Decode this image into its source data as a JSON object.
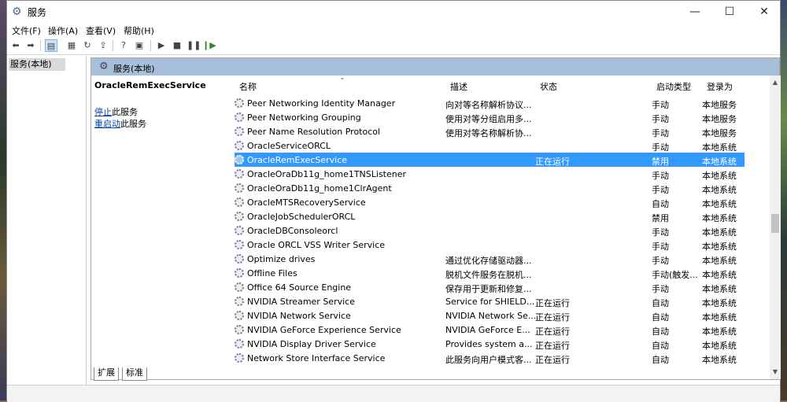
{
  "window": {
    "title": "服务"
  },
  "menu": [
    "文件(F)",
    "操作(A)",
    "查看(V)",
    "帮助(H)"
  ],
  "tree": {
    "selected": "服务(本地)"
  },
  "panel": {
    "header": "服务(本地)",
    "selected_service": "OracleRemExecService",
    "stop_link": "停止",
    "stop_suffix": "此服务",
    "restart_link": "重启动",
    "restart_suffix": "此服务"
  },
  "columns": [
    "名称",
    "描述",
    "状态",
    "启动类型",
    "登录为"
  ],
  "services": [
    {
      "name": "Peer Networking Identity Manager",
      "desc": "向对等名称解析协议...",
      "status": "",
      "startup": "手动",
      "logon": "本地服务"
    },
    {
      "name": "Peer Networking Grouping",
      "desc": "使用对等分组启用多...",
      "status": "",
      "startup": "手动",
      "logon": "本地服务"
    },
    {
      "name": "Peer Name Resolution Protocol",
      "desc": "使用对等名称解析协...",
      "status": "",
      "startup": "手动",
      "logon": "本地服务"
    },
    {
      "name": "OracleServiceORCL",
      "desc": "",
      "status": "",
      "startup": "手动",
      "logon": "本地系统"
    },
    {
      "name": "OracleRemExecService",
      "desc": "",
      "status": "正在运行",
      "startup": "禁用",
      "logon": "本地系统",
      "selected": true
    },
    {
      "name": "OracleOraDb11g_home1TNSListener",
      "desc": "",
      "status": "",
      "startup": "手动",
      "logon": "本地系统"
    },
    {
      "name": "OracleOraDb11g_home1ClrAgent",
      "desc": "",
      "status": "",
      "startup": "手动",
      "logon": "本地系统"
    },
    {
      "name": "OracleMTSRecoveryService",
      "desc": "",
      "status": "",
      "startup": "自动",
      "logon": "本地系统"
    },
    {
      "name": "OracleJobSchedulerORCL",
      "desc": "",
      "status": "",
      "startup": "禁用",
      "logon": "本地系统"
    },
    {
      "name": "OracleDBConsoleorcl",
      "desc": "",
      "status": "",
      "startup": "手动",
      "logon": "本地系统"
    },
    {
      "name": "Oracle ORCL VSS Writer Service",
      "desc": "",
      "status": "",
      "startup": "手动",
      "logon": "本地系统"
    },
    {
      "name": "Optimize drives",
      "desc": "通过优化存储驱动器...",
      "status": "",
      "startup": "手动",
      "logon": "本地系统"
    },
    {
      "name": "Offline Files",
      "desc": "脱机文件服务在脱机...",
      "status": "",
      "startup": "手动(触发...",
      "logon": "本地系统"
    },
    {
      "name": "Office 64 Source Engine",
      "desc": "保存用于更新和修复...",
      "status": "",
      "startup": "手动",
      "logon": "本地系统"
    },
    {
      "name": "NVIDIA Streamer Service",
      "desc": "Service for SHIELD...",
      "status": "正在运行",
      "startup": "自动",
      "logon": "本地系统"
    },
    {
      "name": "NVIDIA Network Service",
      "desc": "NVIDIA Network Se...",
      "status": "正在运行",
      "startup": "自动",
      "logon": "本地系统"
    },
    {
      "name": "NVIDIA GeForce Experience Service",
      "desc": "NVIDIA GeForce E...",
      "status": "正在运行",
      "startup": "自动",
      "logon": "本地系统"
    },
    {
      "name": "NVIDIA Display Driver Service",
      "desc": "Provides system a...",
      "status": "正在运行",
      "startup": "自动",
      "logon": "本地系统"
    },
    {
      "name": "Network Store Interface Service",
      "desc": "此服务向用户模式客...",
      "status": "正在运行",
      "startup": "自动",
      "logon": "本地系统"
    }
  ],
  "tabs": [
    "扩展",
    "标准"
  ]
}
